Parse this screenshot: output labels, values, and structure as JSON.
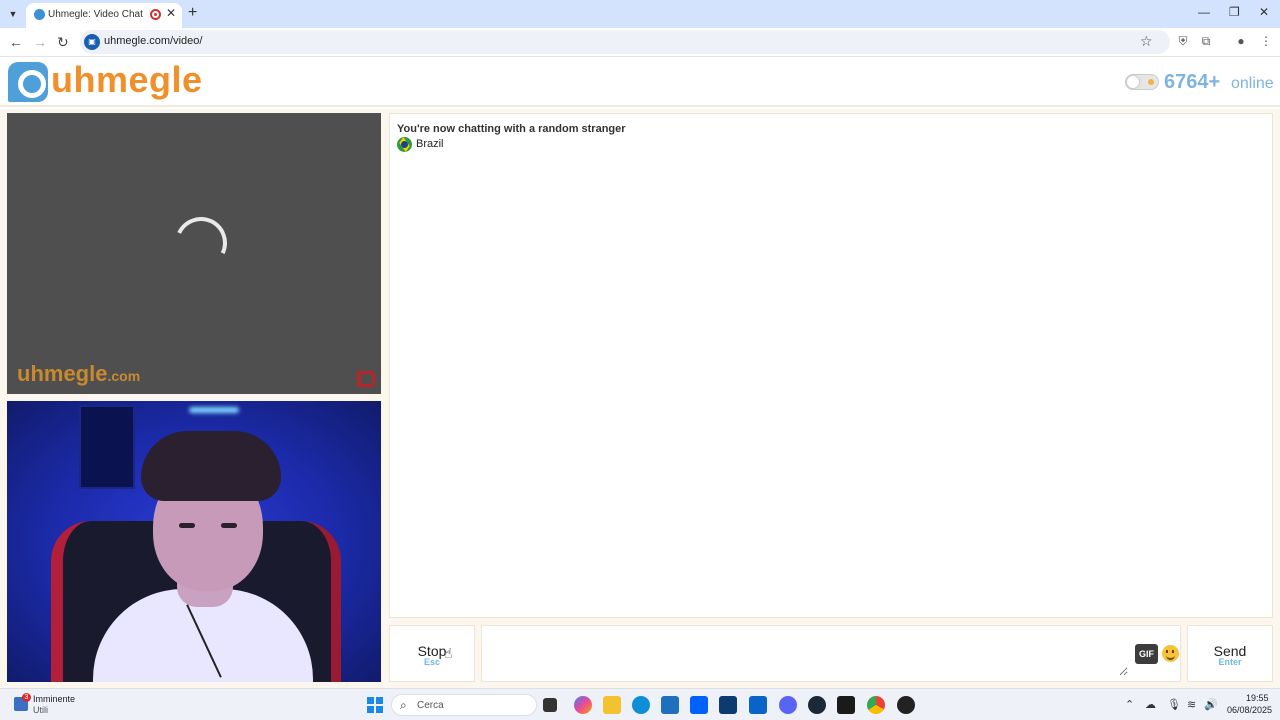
{
  "browser": {
    "tab_title": "Uhmegle: Video Chat | Omegle Alternative",
    "new_tab": "+",
    "url": "uhmegle.com/video/",
    "window_controls": {
      "minimize": "—",
      "restore": "❐",
      "close": "✕"
    }
  },
  "site": {
    "logo_text": "uhmegle",
    "online_count": "6764+",
    "online_label": "online"
  },
  "stranger_video": {
    "watermark": "uhmegle",
    "watermark_suffix": ".com"
  },
  "chat": {
    "status_message": "You're now chatting with a random stranger",
    "country": "Brazil"
  },
  "controls": {
    "stop_label": "Stop",
    "stop_shortcut": "Esc",
    "gif_label": "GIF",
    "send_label": "Send",
    "send_shortcut": "Enter",
    "message_placeholder": ""
  },
  "taskbar": {
    "weather_badge": "3",
    "weather_title": "Imminente",
    "weather_subtitle": "Utili",
    "search_label": "Cerca",
    "time": "19:55",
    "date": "06/08/2025"
  },
  "colors": {
    "brand_orange": "#f0902a",
    "brand_blue": "#4f9fd8",
    "online_blue": "#7fb3e0",
    "shortcut_blue": "#6fb9e8"
  }
}
